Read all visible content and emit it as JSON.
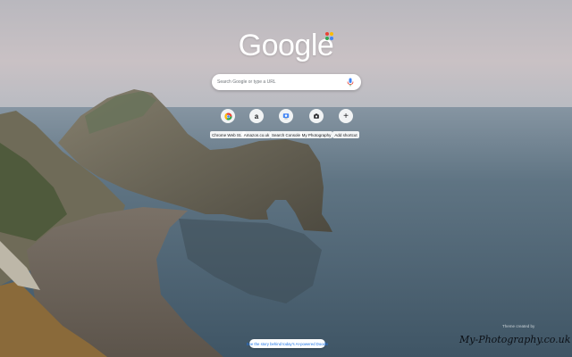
{
  "logo": {
    "text": "Google"
  },
  "search": {
    "placeholder": "Search Google or type a URL"
  },
  "shortcuts": [
    {
      "label": "Chrome Web St...",
      "icon": "chrome-web-store-icon"
    },
    {
      "label": "Amazon.co.uk",
      "icon": "amazon-icon"
    },
    {
      "label": "Search Console",
      "icon": "search-console-icon"
    },
    {
      "label": "My Photography",
      "icon": "photography-icon"
    },
    {
      "label": "Add shortcut",
      "icon": "plus-icon"
    }
  ],
  "footer": {
    "story_link": "See the story behind today's AI-powered Doodle",
    "theme_credit": "Theme created by",
    "theme_author": "My-Photography.co.uk"
  },
  "colors": {
    "sky_top": "#cfc7c8",
    "sea": "#4e6475",
    "link": "#1a73e8"
  }
}
